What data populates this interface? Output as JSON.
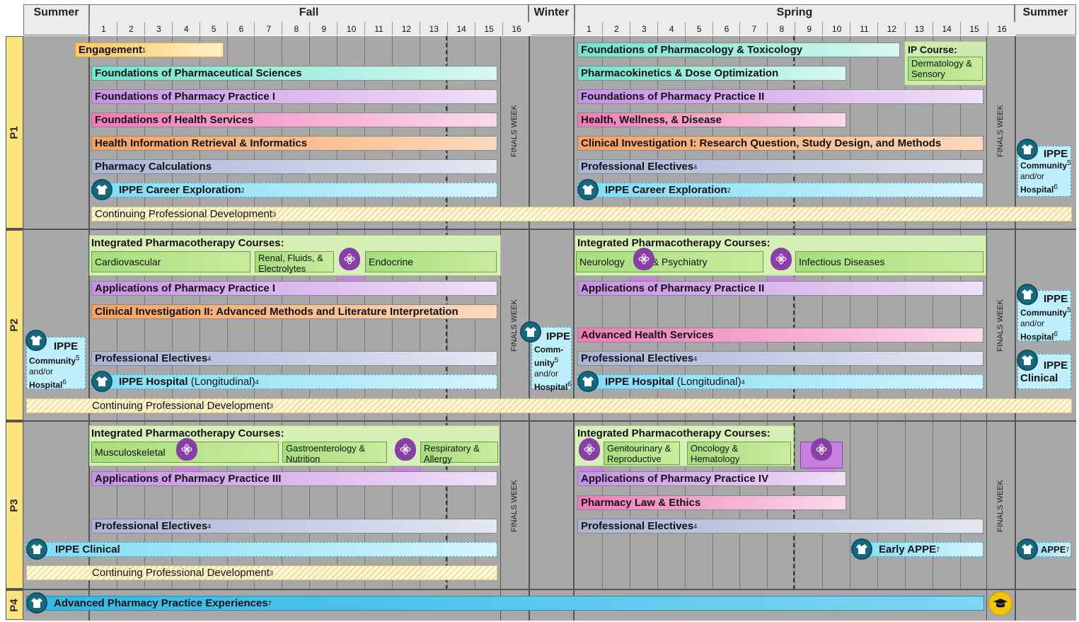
{
  "terms": {
    "summer1": "Summer",
    "fall": "Fall",
    "winter": "Winter",
    "spring": "Spring",
    "summer2": "Summer"
  },
  "fall_weeks": [
    "1",
    "2",
    "3",
    "4",
    "5",
    "6",
    "7",
    "8",
    "9",
    "10",
    "11",
    "12",
    "13",
    "14",
    "15",
    "16"
  ],
  "spring_weeks": [
    "1",
    "2",
    "3",
    "4",
    "5",
    "6",
    "7",
    "8",
    "9",
    "10",
    "11",
    "12",
    "13",
    "14",
    "15",
    "16"
  ],
  "rows": {
    "p1": "P1",
    "p2": "P2",
    "p3": "P3",
    "p4": "P4"
  },
  "finals": "FINALS WEEK",
  "p1": {
    "engagement": "Engagement",
    "engagement_sup": "1",
    "fall_bars": [
      "Foundations of Pharmaceutical Sciences",
      "Foundations of Pharmacy Practice I",
      "Foundations of Health Services",
      "Health Information Retrieval & Informatics",
      "Pharmacy Calculations"
    ],
    "ippe_career": "IPPE Career Exploration",
    "ippe_career_sup": "2",
    "cpd": "Continuing Professional Development",
    "cpd_sup": "3",
    "spring_bars": [
      "Foundations of Pharmacology & Toxicology",
      "Pharmacokinetics & Dose Optimization",
      "Foundations of Pharmacy Practice II",
      "Health, Wellness, & Disease",
      "Clinical Investigation I: Research Question, Study Design, and Methods"
    ],
    "prof_electives": "Professional Electives",
    "prof_electives_sup": "4",
    "ip_course_title": "IP Course:",
    "ip_course_sub": "Dermatology & Sensory",
    "summer_ippe": "IPPE",
    "summer_community": "Community",
    "summer_sup5": "5",
    "summer_andor": "and/or",
    "summer_hospital": "Hospital",
    "summer_sup6": "6"
  },
  "p2": {
    "ipc_title": "Integrated Pharmacotherapy Courses:",
    "fall_ipc": [
      "Cardiovascular",
      "Renal, Fluids, & Electrolytes",
      "Endocrine"
    ],
    "spring_ipc": [
      "Neurology",
      "& Psychiatry",
      "Infectious Diseases"
    ],
    "app1": "Applications of Pharmacy Practice I",
    "ci2": "Clinical Investigation II: Advanced Methods and Literature Interpretation",
    "prof_electives": "Professional Electives",
    "sup4": "4",
    "ippe_hospital": "IPPE Hospital",
    "longitudinal": "(Longitudinal)",
    "app2": "Applications of Pharmacy Practice II",
    "adv_health": "Advanced Health Services",
    "cpd": "Continuing Professional Development",
    "sup3": "3",
    "left_ippe": "IPPE",
    "left_community": "Community",
    "left_andor": "and/or",
    "left_hospital": "Hospital",
    "sup5": "5",
    "sup6": "6",
    "winter_ippe": "IPPE",
    "winter_comm": "Comm-",
    "winter_unity": "unity",
    "winter_andor": "and/or",
    "winter_hospital": "Hospital",
    "right_ippe": "IPPE",
    "right_community": "Community",
    "right_andor": "and/or",
    "right_hospital": "Hospital",
    "right2_ippe": "IPPE",
    "right2_clinical": "Clinical"
  },
  "p3": {
    "ipc_title": "Integrated Pharmacotherapy Courses:",
    "fall_ipc": [
      "Musculoskeletal",
      "Gastroenterology & Nutrition",
      "Respiratory & Allergy"
    ],
    "spring_ipc": [
      "Genitourinary & Reproductive",
      "Oncology & Hematology"
    ],
    "app3": "Applications of Pharmacy Practice III",
    "app4": "Applications of Pharmacy Practice IV",
    "law": "Pharmacy Law & Ethics",
    "prof_electives": "Professional Electives",
    "sup4": "4",
    "ippe_clinical": "IPPE Clinical",
    "early_appe": "Early APPE",
    "sup7": "7",
    "cpd": "Continuing Professional Development",
    "sup3": "3",
    "summer_appe": "APPE"
  },
  "p4": {
    "appe": "Advanced Pharmacy Practice Experiences",
    "sup7": "7"
  }
}
